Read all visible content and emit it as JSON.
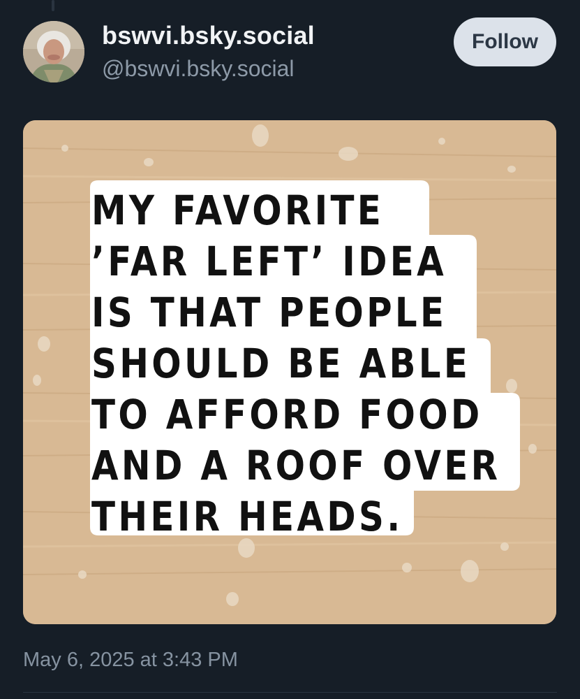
{
  "author": {
    "display_name": "bswvi.bsky.social",
    "handle": "@bswvi.bsky.social",
    "avatar_icon": "user-avatar-photo"
  },
  "actions": {
    "follow_label": "Follow"
  },
  "post": {
    "image_text_lines": [
      "MY FAVORITE",
      "’FAR LEFT’ IDEA",
      "IS THAT PEOPLE",
      "SHOULD BE ABLE",
      "TO AFFORD FOOD",
      "AND A ROOF OVER",
      "THEIR HEADS."
    ],
    "timestamp": "May 6, 2025 at 3:43 PM"
  },
  "colors": {
    "background": "#161e27",
    "follow_button_bg": "#dce2ea",
    "wood": "#d8b994"
  }
}
